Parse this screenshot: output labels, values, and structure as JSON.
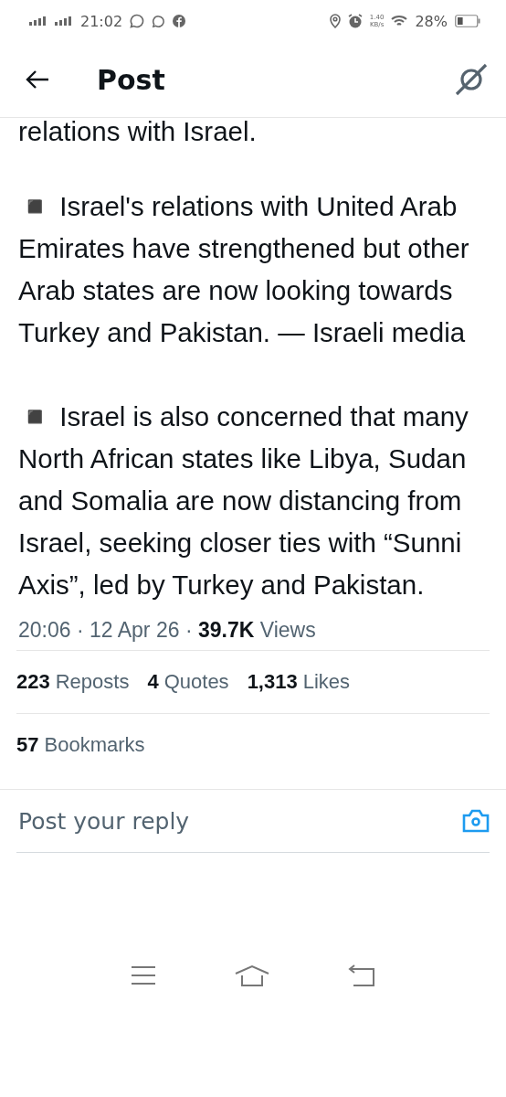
{
  "status_bar": {
    "time": "21:02",
    "speed_value": "1.40",
    "speed_unit": "KB/s",
    "battery_text": "28%",
    "battery": {
      "level": 0.28
    }
  },
  "header": {
    "title": "Post"
  },
  "post": {
    "cut_line": "relations with Israel.",
    "paragraphs": [
      {
        "bullet": "◾",
        "text": "Israel's relations with United Arab Emirates have strengthened but other Arab states are now looking towards Turkey and Pakistan.  — Israeli media"
      },
      {
        "bullet": "◾",
        "text": "Israel is also concerned that many North African states like Libya, Sudan and Somalia are now distancing from Israel, seeking closer ties with “Sunni Axis”, led by Turkey and Pakistan."
      }
    ],
    "meta": {
      "time": "20:06",
      "sep_1": "·",
      "date": "12 Apr 26",
      "sep_2": "·",
      "views_count": "39.7K",
      "views_label": "Views"
    },
    "stats": [
      {
        "count": "223",
        "label": "Reposts"
      },
      {
        "count": "4",
        "label": "Quotes"
      },
      {
        "count": "1,313",
        "label": "Likes"
      }
    ],
    "bookmarks": {
      "count": "57",
      "label": "Bookmarks"
    }
  },
  "reply": {
    "placeholder": "Post your reply"
  }
}
